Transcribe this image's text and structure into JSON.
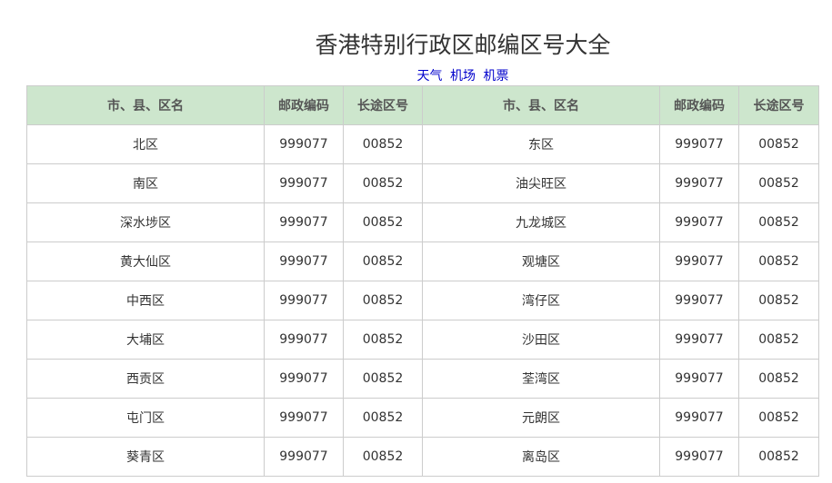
{
  "page": {
    "title": "香港特别行政区邮编区号大全",
    "links": [
      "天气",
      "机场",
      "机票"
    ]
  },
  "table": {
    "headers": [
      "市、县、区名",
      "邮政编码",
      "长途区号",
      "市、县、区名",
      "邮政编码",
      "长途区号"
    ],
    "rows": [
      [
        "北区",
        "999077",
        "00852",
        "东区",
        "999077",
        "00852"
      ],
      [
        "南区",
        "999077",
        "00852",
        "油尖旺区",
        "999077",
        "00852"
      ],
      [
        "深水埗区",
        "999077",
        "00852",
        "九龙城区",
        "999077",
        "00852"
      ],
      [
        "黄大仙区",
        "999077",
        "00852",
        "观塘区",
        "999077",
        "00852"
      ],
      [
        "中西区",
        "999077",
        "00852",
        "湾仔区",
        "999077",
        "00852"
      ],
      [
        "大埔区",
        "999077",
        "00852",
        "沙田区",
        "999077",
        "00852"
      ],
      [
        "西贡区",
        "999077",
        "00852",
        "荃湾区",
        "999077",
        "00852"
      ],
      [
        "屯门区",
        "999077",
        "00852",
        "元朗区",
        "999077",
        "00852"
      ],
      [
        "葵青区",
        "999077",
        "00852",
        "离岛区",
        "999077",
        "00852"
      ]
    ]
  },
  "colors": {
    "header_bg": "#cde6cd",
    "link": "#0000cc",
    "border": "#cccccc"
  }
}
